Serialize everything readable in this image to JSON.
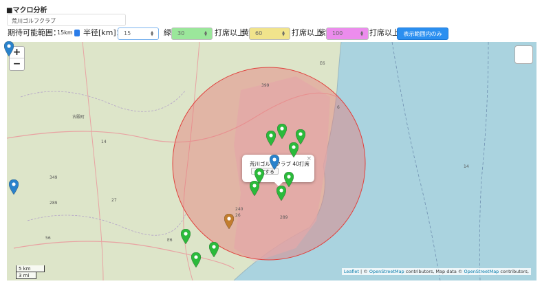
{
  "page": {
    "title": "■マクロ分析"
  },
  "course": {
    "value": "荒川ゴルフクラブ"
  },
  "controls": {
    "range_label": "期待可能範囲：",
    "range_value": "15km",
    "radius_label": "半径[km]：",
    "radius_value": "15",
    "green_label": "緑",
    "green_value": "30",
    "green_suffix": "打席以上",
    "yellow_label": "黄",
    "yellow_value": "60",
    "yellow_suffix": "打席以上",
    "purple_label": "紫",
    "purple_value": "100",
    "purple_suffix": "打席以上",
    "visible_button": "表示範囲内のみ"
  },
  "colors": {
    "green_field": "#9be79b",
    "yellow_field": "#f1e48c",
    "purple_field": "#ec8ced",
    "button": "#2b8ff0",
    "circle_fill": "#e77a7a",
    "circle_stroke": "#e0403c",
    "sea": "#aad3df",
    "pin_green": "#2bba3b",
    "pin_blue": "#2a82cb",
    "pin_orange": "#c27d2e"
  },
  "map": {
    "zoom_in": "+",
    "zoom_out": "−",
    "scale_km": "5 km",
    "scale_mi": "3 mi",
    "popup_text": "荒川ゴルフクラブ 40打席",
    "popup_button": "指定する",
    "popup_close": "×",
    "labels": [
      "399",
      "6",
      "E6",
      "古殿町",
      "14",
      "349",
      "289",
      "27",
      "56",
      "240",
      "26",
      "289",
      "E6",
      "14"
    ],
    "attribution": {
      "leaflet": "Leaflet",
      "sep1": " | © ",
      "osm1": "OpenStreetMap",
      "mid": " contributors, Map data © ",
      "osm2": "OpenStreetMap",
      "end": " contributors,"
    }
  }
}
